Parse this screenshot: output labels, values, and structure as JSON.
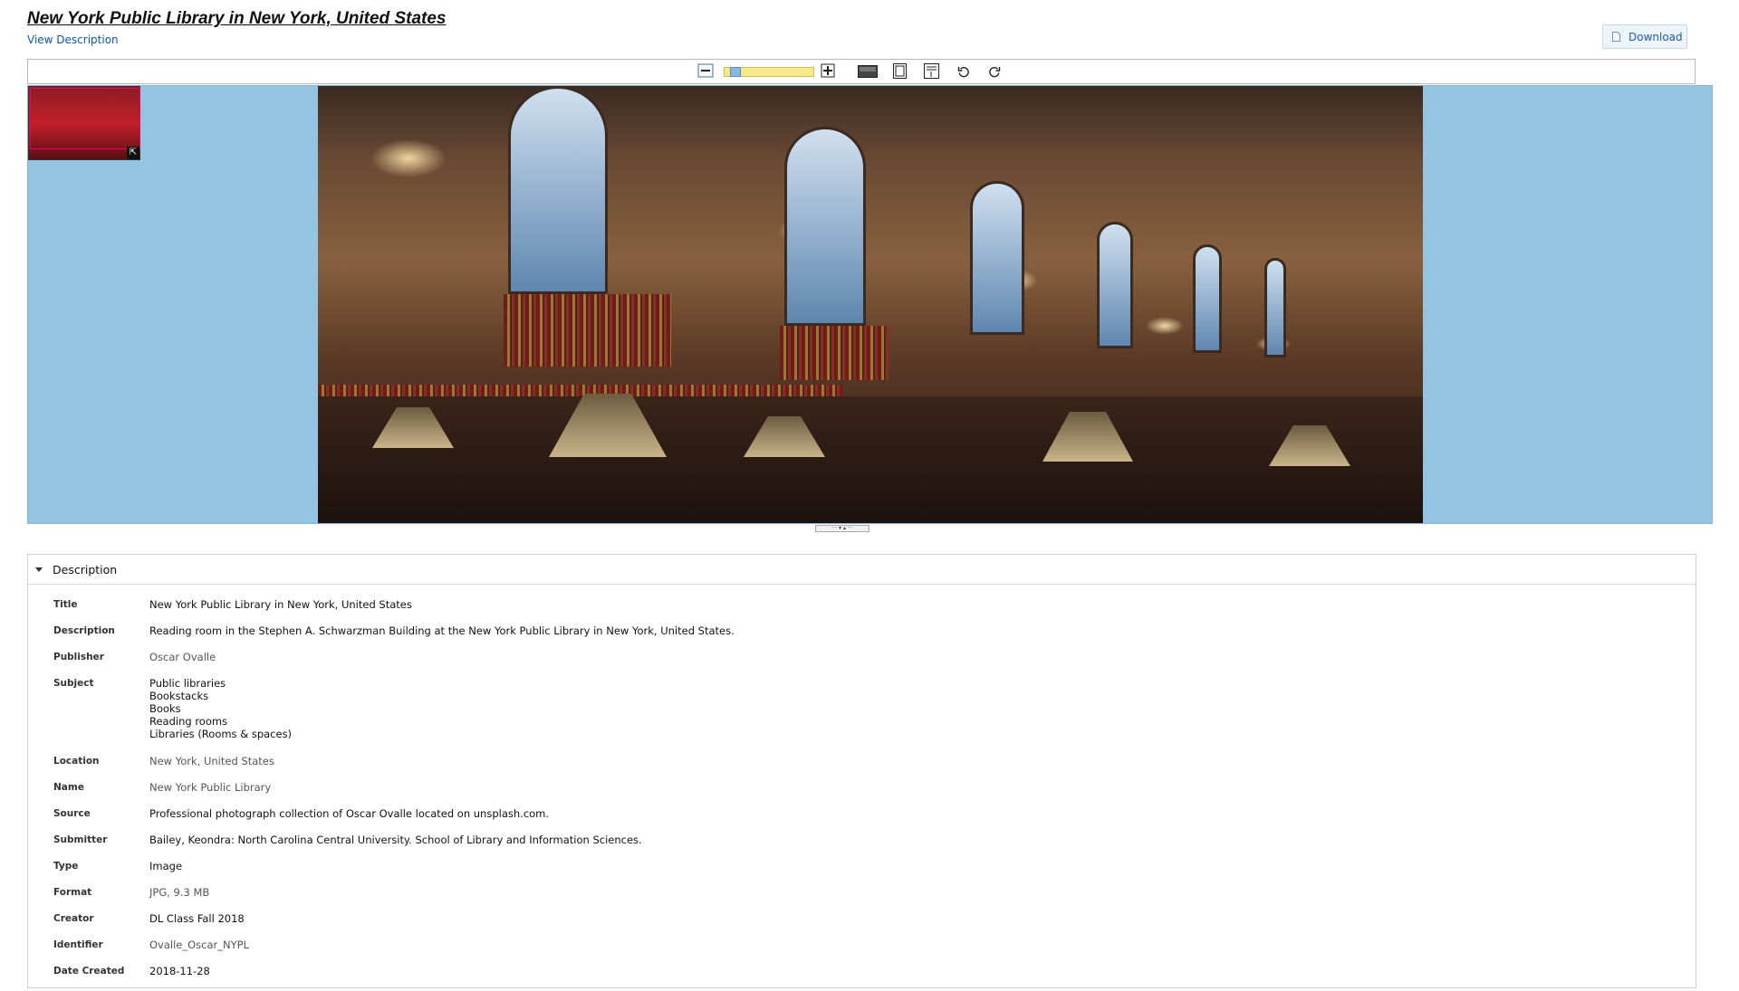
{
  "header": {
    "title": "New York Public Library in New York, United States",
    "view_description": "View Description",
    "download_label": "Download"
  },
  "viewer": {
    "toolbar": {
      "zoom_level": 0.08,
      "tools": [
        "zoom-out",
        "zoom-in",
        "fit-width",
        "fit-window",
        "fit-page",
        "rotate-left",
        "rotate-right"
      ]
    },
    "colors": {
      "stage_bg": "#93c4e2",
      "zoom_track": "#f6e98a",
      "zoom_thumb": "#8bb8e2"
    }
  },
  "description": {
    "header": "Description",
    "fields": {
      "title": {
        "label": "Title",
        "value": "New York Public Library in New York, United States"
      },
      "description": {
        "label": "Description",
        "value": "Reading room in the Stephen A. Schwarzman Building at the New York Public Library in New York, United States."
      },
      "publisher": {
        "label": "Publisher",
        "value": "Oscar Ovalle"
      },
      "subject": {
        "label": "Subject",
        "values": [
          "Public libraries",
          "Bookstacks",
          "Books",
          "Reading rooms",
          "Libraries (Rooms & spaces)"
        ]
      },
      "location": {
        "label": "Location",
        "value": "New York, United States"
      },
      "name": {
        "label": "Name",
        "value": "New York Public Library"
      },
      "source": {
        "label": "Source",
        "value": "Professional photograph collection of Oscar Ovalle located on unsplash.com."
      },
      "submitter": {
        "label": "Submitter",
        "value": "Bailey, Keondra: North Carolina Central University. School of Library and Information Sciences."
      },
      "type": {
        "label": "Type",
        "value": "Image"
      },
      "format": {
        "label": "Format",
        "value": "JPG, 9.3 MB"
      },
      "creator": {
        "label": "Creator",
        "value": "DL Class Fall 2018"
      },
      "identifier": {
        "label": "Identifier",
        "value": "Ovalle_Oscar_NYPL"
      },
      "date_created": {
        "label": "Date Created",
        "value": "2018-11-28"
      }
    }
  }
}
